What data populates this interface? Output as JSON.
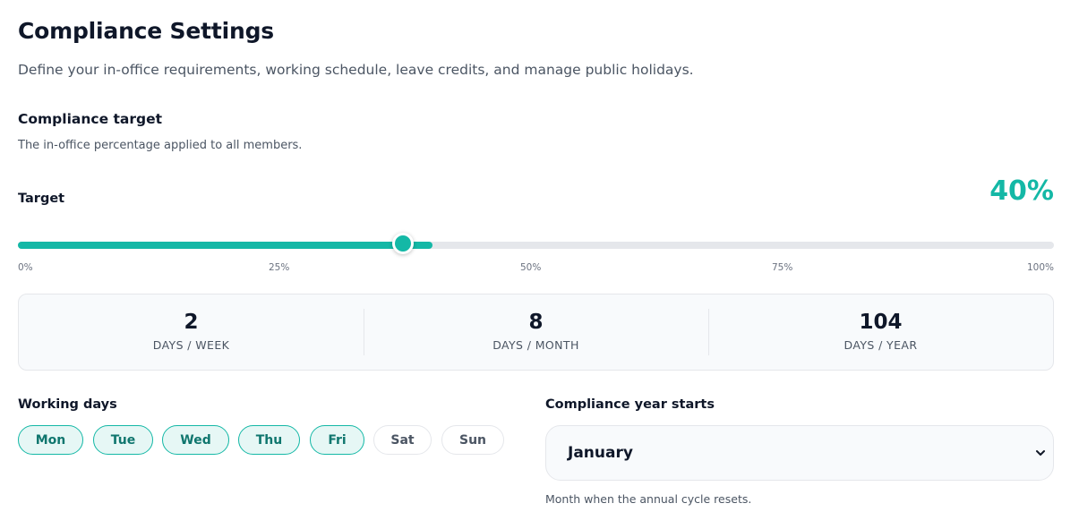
{
  "header": {
    "title": "Compliance Settings",
    "subtitle": "Define your in-office requirements, working schedule, leave credits, and manage public holidays."
  },
  "compliance_target": {
    "title": "Compliance target",
    "description": "The in-office percentage applied to all members.",
    "target_label": "Target",
    "target_value": "40%",
    "slider_percent": 40,
    "ticks": [
      "0%",
      "25%",
      "50%",
      "75%",
      "100%"
    ]
  },
  "stats": [
    {
      "value": "2",
      "label": "DAYS / WEEK"
    },
    {
      "value": "8",
      "label": "DAYS / MONTH"
    },
    {
      "value": "104",
      "label": "DAYS / YEAR"
    }
  ],
  "working_days": {
    "label": "Working days",
    "days": [
      {
        "label": "Mon",
        "selected": true
      },
      {
        "label": "Tue",
        "selected": true
      },
      {
        "label": "Wed",
        "selected": true
      },
      {
        "label": "Thu",
        "selected": true
      },
      {
        "label": "Fri",
        "selected": true
      },
      {
        "label": "Sat",
        "selected": false
      },
      {
        "label": "Sun",
        "selected": false
      }
    ]
  },
  "compliance_year": {
    "label": "Compliance year starts",
    "selected_month": "January",
    "help": "Month when the annual cycle resets."
  },
  "colors": {
    "accent": "#14b8a6",
    "accent_light": "#e6f7f5",
    "track": "#e5e7eb"
  },
  "icons": {
    "select_chevron": "chevron-down-icon"
  }
}
